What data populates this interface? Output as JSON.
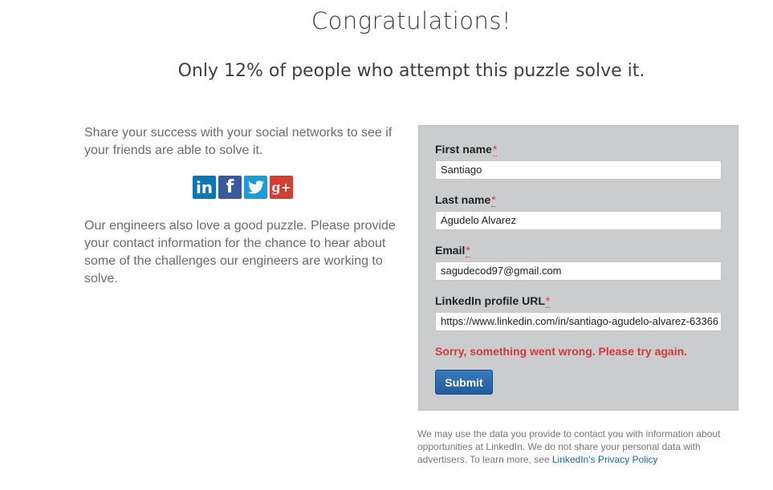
{
  "header": {
    "title": "Congratulations!",
    "subtitle": "Only 12% of people who attempt this puzzle solve it."
  },
  "share": {
    "text": "Share your success with your social networks to see if your friends are able to solve it.",
    "icons": [
      "linkedin-icon",
      "facebook-icon",
      "twitter-icon",
      "google-plus-icon"
    ],
    "linkedin_glyph": "in",
    "facebook_glyph": "f",
    "google_glyph": "g+"
  },
  "engineers_text": "Our engineers also love a good puzzle. Please provide your contact information for the chance to hear about some of the challenges our engineers are working to solve.",
  "form": {
    "required_mark": "*",
    "first_name_label": "First name",
    "first_name_value": "Santiago",
    "last_name_label": "Last name",
    "last_name_value": "Agudelo Alvarez",
    "email_label": "Email",
    "email_value": "sagudecod97@gmail.com",
    "linkedin_label": "LinkedIn profile URL",
    "linkedin_value": "https://www.linkedin.com/in/santiago-agudelo-alvarez-63366",
    "error_text": "Sorry, something went wrong. Please try again.",
    "submit_label": "Submit"
  },
  "disclaimer": {
    "text": "We may use the data you provide to contact you with information about opportunities at LinkedIn. We do not share your personal data with advertisers. To learn more, see ",
    "link_text": "LinkedIn's Privacy Policy"
  },
  "colors": {
    "error": "#d13b3b",
    "submit": "#2a6aad",
    "form_background": "#cbcccd",
    "link": "#1a67b0"
  }
}
